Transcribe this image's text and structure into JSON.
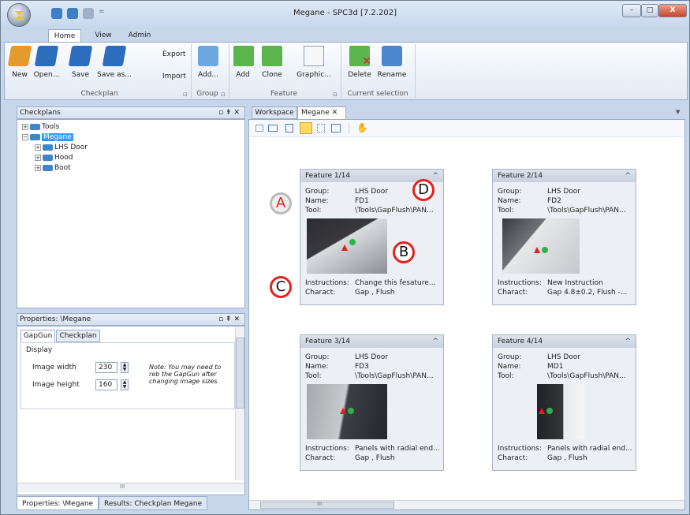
{
  "window": {
    "title": "Megane - SPC3d [7.2.202]",
    "minimize": "–",
    "maximize": "□",
    "close": "X"
  },
  "ribbon_tabs": [
    "Home",
    "View",
    "Admin"
  ],
  "ribbon": {
    "checkplan": {
      "new": "New",
      "open": "Open...",
      "save": "Save",
      "save_as": "Save as...",
      "export": "Export",
      "import": "Import",
      "group_label": "Checkplan"
    },
    "group": {
      "add": "Add...",
      "group_label": "Group"
    },
    "feature": {
      "add": "Add",
      "clone": "Clone",
      "graphic": "Graphic...",
      "group_label": "Feature"
    },
    "current_selection": {
      "delete": "Delete",
      "rename": "Rename",
      "group_label": "Current selection"
    }
  },
  "checkplans": {
    "header": "Checkplans",
    "tree": [
      {
        "label": "Tools",
        "level": 0
      },
      {
        "label": "Megane",
        "level": 0,
        "selected": true
      },
      {
        "label": "LHS Door",
        "level": 1
      },
      {
        "label": "Hood",
        "level": 1
      },
      {
        "label": "Boot",
        "level": 1
      }
    ]
  },
  "properties": {
    "header": "Properties: \\Megane",
    "tabs": [
      "GapGun",
      "Checkplan"
    ],
    "section": "Display",
    "image_width_label": "Image width",
    "image_width_value": "230",
    "image_height_label": "Image height",
    "image_height_value": "160",
    "note": "Note: You may need to reb the GapGun after changing image sizes",
    "bottom_tabs": [
      "Properties: \\Megane",
      "Results: Checkplan Megane"
    ],
    "scroll_mark": "III"
  },
  "workspace": {
    "tabs": [
      "Workspace",
      "Megane"
    ],
    "close_glyph": "✕",
    "scroll_mark": "III",
    "field_labels": {
      "group": "Group:",
      "name": "Name:",
      "tool": "Tool:",
      "instructions": "Instructions:",
      "charact": "Charact:"
    },
    "features": [
      {
        "title": "Feature 1/14",
        "group": "LHS Door",
        "name": "FD1",
        "tool": "\\Tools\\GapFlush\\PAN...",
        "instructions": "Change this fesature...",
        "charact": "Gap , Flush"
      },
      {
        "title": "Feature 2/14",
        "group": "LHS Door",
        "name": "FD2",
        "tool": "\\Tools\\GapFlush\\PAN...",
        "instructions": "New Instruction",
        "charact": "Gap 4.8±0.2, Flush -..."
      },
      {
        "title": "Feature 3/14",
        "group": "LHS Door",
        "name": "FD3",
        "tool": "\\Tools\\GapFlush\\PAN...",
        "instructions": "Panels with radial end...",
        "charact": "Gap , Flush"
      },
      {
        "title": "Feature 4/14",
        "group": "LHS Door",
        "name": "MD1",
        "tool": "\\Tools\\GapFlush\\PAN...",
        "instructions": "Panels with radial end...",
        "charact": "Gap , Flush"
      }
    ]
  },
  "callouts": [
    "A",
    "B",
    "C",
    "D"
  ]
}
